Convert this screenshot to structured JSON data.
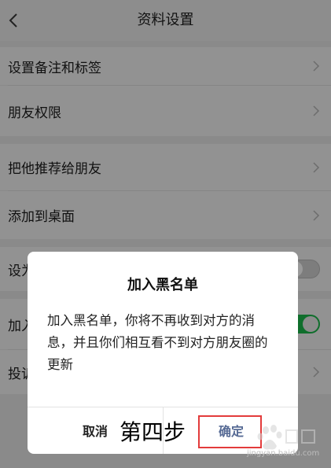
{
  "header": {
    "title": "资料设置"
  },
  "rows": [
    {
      "label": "设置备注和标签",
      "control": "chevron"
    },
    {
      "label": "朋友权限",
      "control": "chevron"
    },
    {
      "label": "把他推荐给朋友",
      "control": "chevron"
    },
    {
      "label": "添加到桌面",
      "control": "chevron"
    },
    {
      "label": "设为",
      "control": "toggle-off"
    },
    {
      "label": "加入",
      "control": "toggle-on"
    },
    {
      "label": "投诉",
      "control": "chevron"
    }
  ],
  "dialog": {
    "title": "加入黑名单",
    "message": "加入黑名单，你将不再收到对方的消息，并且你们相互看不到对方朋友圈的更新",
    "cancel_label": "取消",
    "confirm_label": "确定"
  },
  "annotation": {
    "step_text": "第四步"
  },
  "watermark": {
    "text": "jingyan.baidu.com"
  },
  "colors": {
    "accent_green": "#0f6e2c",
    "confirm_blue": "#576b95",
    "highlight_red": "#e33b3b"
  }
}
